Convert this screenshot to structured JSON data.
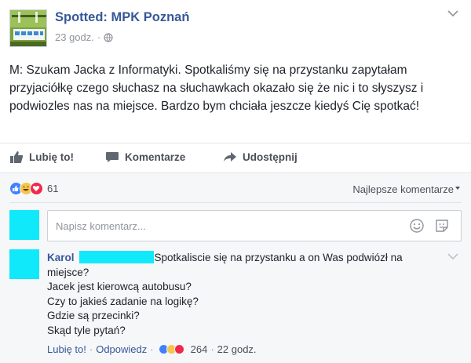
{
  "post": {
    "page_name": "Spotted: MPK Poznań",
    "time": "23 godz.",
    "dot": "·",
    "text": "M: Szukam Jacka z Informatyki. Spotkaliśmy się na przystanku zapytałam przyjaciółkę czego słuchasz na słuchawkach okazało się że nic i to słyszysz i podwiozles nas na miejsce. Bardzo bym chciała jeszcze kiedyś Cię spotkać!",
    "icons": {
      "globe": "globe-icon",
      "menu": "chevron-down-icon"
    }
  },
  "actions": {
    "like": "Lubię to!",
    "comment": "Komentarze",
    "share": "Udostępnij"
  },
  "reactions": {
    "count": "61",
    "types": [
      "like",
      "haha",
      "love"
    ],
    "colors": {
      "like": "#4080ff",
      "haha": "#f7c44a",
      "love": "#f0284a"
    }
  },
  "comments_header": {
    "sort_label": "Najlepsze komentarze"
  },
  "composer": {
    "placeholder": "Napisz komentarz..."
  },
  "comment": {
    "author": "Karol",
    "lines": [
      "Spotkaliscie się na przystanku a on Was podwiózł na miejsce?",
      "Jacek jest kierowcą autobusu?",
      "Czy to jakieś zadanie na logikę?",
      "Gdzie są przecinki?",
      "Skąd tyle pytań?"
    ],
    "like": "Lubię to!",
    "reply": "Odpowiedz",
    "reaction_count": "264",
    "time": "22 godz.",
    "dot": "·"
  },
  "colors": {
    "link": "#365899",
    "redaction": "#10e9fa",
    "background_grey": "#f6f7f9"
  }
}
